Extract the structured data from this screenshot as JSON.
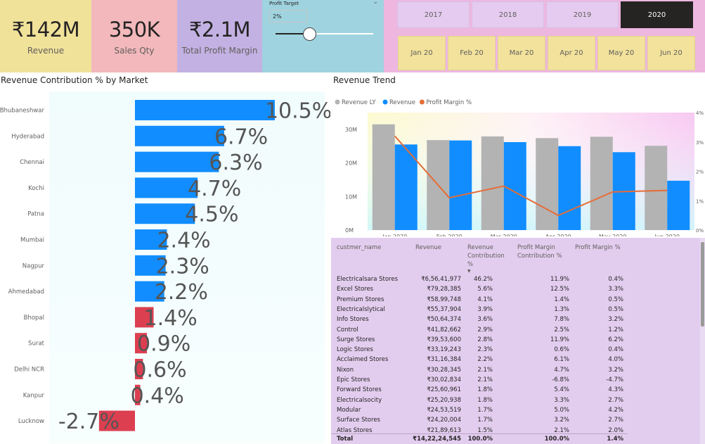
{
  "kpis": {
    "revenue": {
      "value": "₹142M",
      "label": "Revenue"
    },
    "sales_qty": {
      "value": "350K",
      "label": "Sales Qty"
    },
    "profit_margin": {
      "value": "₹2.1M",
      "label": "Total Profit Margin"
    }
  },
  "profit_target": {
    "title": "Profit Target",
    "value": "2%",
    "slider_fraction": 0.3
  },
  "years": [
    "2017",
    "2018",
    "2019",
    "2020"
  ],
  "selected_year": "2020",
  "months": [
    "Jan 20",
    "Feb 20",
    "Mar 20",
    "Apr 20",
    "May 20",
    "Jun 20"
  ],
  "market_title": "Revenue Contribution % by Market",
  "trend_title": "Revenue Trend",
  "colors": {
    "positive": "#118dff",
    "negative": "#dc3f50",
    "revenue_ly": "#b3b3b3",
    "revenue": "#118dff",
    "margin": "#e66c37"
  },
  "chart_data": [
    {
      "type": "bar",
      "orientation": "horizontal",
      "title": "Revenue Contribution % by Market",
      "categories": [
        "Bhubaneshwar",
        "Hyderabad",
        "Chennai",
        "Kochi",
        "Patna",
        "Mumbai",
        "Nagpur",
        "Ahmedabad",
        "Bhopal",
        "Surat",
        "Delhi NCR",
        "Kanpur",
        "Lucknow"
      ],
      "values": [
        10.5,
        6.7,
        6.3,
        4.7,
        4.5,
        2.4,
        2.3,
        2.2,
        1.4,
        0.9,
        0.6,
        0.4,
        -2.7
      ],
      "labels": [
        "10.5%",
        "6.7%",
        "6.3%",
        "4.7%",
        "4.5%",
        "2.4%",
        "2.3%",
        "2.2%",
        "1.4%",
        "0.9%",
        "0.6%",
        "0.4%",
        "-2.7%"
      ],
      "unit": "%"
    },
    {
      "type": "bar",
      "title": "Revenue Trend",
      "categories": [
        "Jan 2020",
        "Feb 2020",
        "Mar 2020",
        "Apr 2020",
        "May 2020",
        "Jun 2020"
      ],
      "series": [
        {
          "name": "Revenue LY",
          "values": [
            31.5,
            26.8,
            27.9,
            27.4,
            27.8,
            25.1
          ]
        },
        {
          "name": "Revenue",
          "values": [
            25.5,
            26.7,
            26.2,
            25.0,
            23.2,
            14.7
          ]
        },
        {
          "name": "Profit Margin %",
          "axis": "right",
          "values": [
            3.2,
            1.1,
            1.5,
            0.5,
            1.3,
            1.35
          ]
        }
      ],
      "legend": "top-left",
      "y_ticks": [
        "0M",
        "10M",
        "20M",
        "30M"
      ],
      "ylim": [
        0,
        35
      ],
      "y2_ticks": [
        "0%",
        "1%",
        "2%",
        "3%",
        "4%"
      ],
      "y2lim": [
        0,
        4
      ]
    }
  ],
  "table": {
    "headers": [
      "custmer_name",
      "Revenue",
      "Revenue Contribution %",
      "Profit Margin Contribution %",
      "Profit Margin %"
    ],
    "rows": [
      [
        "Electricalsara Stores",
        "₹6,56,41,977",
        "46.2%",
        "11.9%",
        "0.4%"
      ],
      [
        "Excel Stores",
        "₹79,28,385",
        "5.6%",
        "12.5%",
        "3.3%"
      ],
      [
        "Premium Stores",
        "₹58,99,748",
        "4.1%",
        "1.4%",
        "0.5%"
      ],
      [
        "Electricalslytical",
        "₹55,37,904",
        "3.9%",
        "1.3%",
        "0.5%"
      ],
      [
        "Info Stores",
        "₹50,64,374",
        "3.6%",
        "7.8%",
        "3.2%"
      ],
      [
        "Control",
        "₹41,82,662",
        "2.9%",
        "2.5%",
        "1.2%"
      ],
      [
        "Surge Stores",
        "₹39,53,600",
        "2.8%",
        "11.9%",
        "6.2%"
      ],
      [
        "Logic Stores",
        "₹33,19,243",
        "2.3%",
        "0.6%",
        "0.4%"
      ],
      [
        "Acclaimed Stores",
        "₹31,16,384",
        "2.2%",
        "6.1%",
        "4.0%"
      ],
      [
        "Nixon",
        "₹30,28,345",
        "2.1%",
        "4.7%",
        "3.2%"
      ],
      [
        "Epic Stores",
        "₹30,02,834",
        "2.1%",
        "-6.8%",
        "-4.7%"
      ],
      [
        "Forward Stores",
        "₹25,60,961",
        "1.8%",
        "5.4%",
        "4.3%"
      ],
      [
        "Electricalsocity",
        "₹25,20,938",
        "1.8%",
        "3.3%",
        "2.7%"
      ],
      [
        "Modular",
        "₹24,53,519",
        "1.7%",
        "5.0%",
        "4.2%"
      ],
      [
        "Surface Stores",
        "₹24,20,004",
        "1.7%",
        "3.2%",
        "2.7%"
      ],
      [
        "Atlas Stores",
        "₹21,89,613",
        "1.5%",
        "2.1%",
        "2.0%"
      ]
    ],
    "total": [
      "Total",
      "₹14,22,24,545",
      "100.0%",
      "100.0%",
      "1.4%"
    ]
  }
}
